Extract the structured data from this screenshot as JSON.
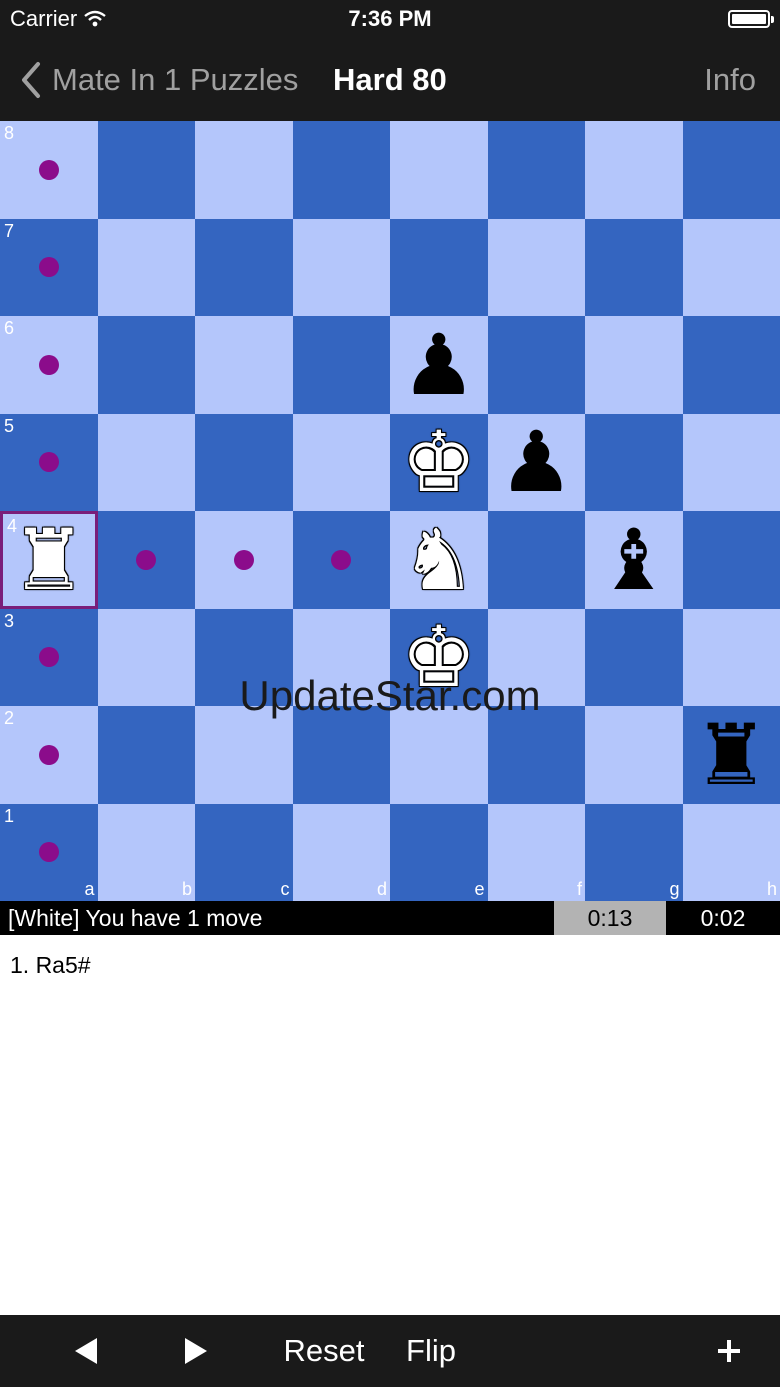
{
  "status_bar": {
    "carrier": "Carrier",
    "time": "7:36 PM"
  },
  "nav": {
    "back_label": "Mate In 1 Puzzles",
    "title": "Hard 80",
    "info_label": "Info"
  },
  "board": {
    "ranks": [
      "8",
      "7",
      "6",
      "5",
      "4",
      "3",
      "2",
      "1"
    ],
    "files": [
      "a",
      "b",
      "c",
      "d",
      "e",
      "f",
      "g",
      "h"
    ],
    "selected_square": "a4",
    "hints": [
      "a8",
      "a7",
      "a6",
      "a5",
      "a3",
      "a2",
      "a1",
      "b4",
      "c4",
      "d4"
    ],
    "pieces": [
      {
        "square": "a4",
        "color": "white",
        "type": "rook",
        "glyph": "♜"
      },
      {
        "square": "e6",
        "color": "black",
        "type": "pawn",
        "glyph": "♟"
      },
      {
        "square": "e5",
        "color": "white",
        "type": "king",
        "glyph": "♚"
      },
      {
        "square": "f5",
        "color": "black",
        "type": "pawn",
        "glyph": "♟"
      },
      {
        "square": "e4",
        "color": "white",
        "type": "knight",
        "glyph": "♞"
      },
      {
        "square": "g4",
        "color": "black",
        "type": "bishop",
        "glyph": "♝"
      },
      {
        "square": "e3",
        "color": "white",
        "type": "king",
        "glyph": "♚"
      },
      {
        "square": "h2",
        "color": "black",
        "type": "rook",
        "glyph": "♜"
      }
    ],
    "colors": {
      "light": "#b4c6fb",
      "dark": "#3465c0",
      "hint": "#8b0c8b",
      "selected_border": "#7a1e7a"
    }
  },
  "watermark": "UpdateStar.com",
  "info_bar": {
    "message": "[White] You have 1 move",
    "timer_1": "0:13",
    "timer_2": "0:02"
  },
  "moves": {
    "text": "1. Ra5#"
  },
  "toolbar": {
    "reset_label": "Reset",
    "flip_label": "Flip"
  }
}
